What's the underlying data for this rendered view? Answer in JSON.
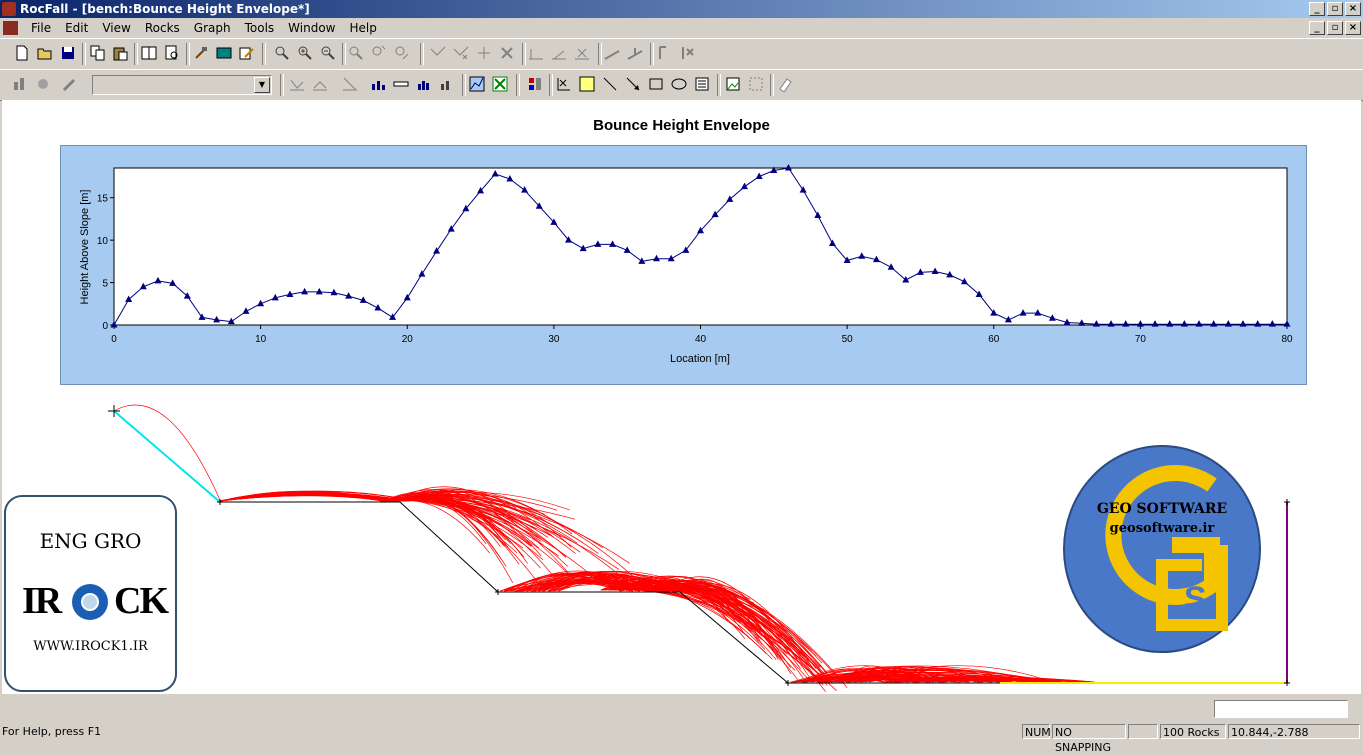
{
  "window": {
    "title": "RocFall - [bench:Bounce Height Envelope*]"
  },
  "menu": {
    "items": [
      "File",
      "Edit",
      "View",
      "Rocks",
      "Graph",
      "Tools",
      "Window",
      "Help"
    ]
  },
  "chart_title": "Bounce Height Envelope",
  "chart_data": {
    "type": "line",
    "title": "Bounce Height Envelope",
    "xlabel": "Location [m]",
    "ylabel": "Height Above Slope [m]",
    "xlim": [
      0,
      80
    ],
    "ylim": [
      0,
      18.5
    ],
    "x_ticks": [
      "0",
      "10",
      "20",
      "30",
      "40",
      "50",
      "60",
      "70",
      "80"
    ],
    "y_ticks": [
      "0",
      "5",
      "10",
      "15"
    ],
    "series": [
      {
        "marker": "triangle",
        "color": "#000080",
        "x": [
          0,
          1,
          2,
          3,
          4,
          5,
          6,
          7,
          8,
          9,
          10,
          11,
          12,
          13,
          14,
          15,
          16,
          17,
          18,
          19,
          20,
          21,
          22,
          23,
          24,
          25,
          26,
          27,
          28,
          29,
          30,
          31,
          32,
          33,
          34,
          35,
          36,
          37,
          38,
          39,
          40,
          41,
          42,
          43,
          44,
          45,
          46,
          47,
          48,
          49,
          50,
          51,
          52,
          53,
          54,
          55,
          56,
          57,
          58,
          59,
          60,
          61,
          62,
          63,
          64,
          65,
          66,
          67,
          68,
          69,
          70,
          71,
          72,
          73,
          74,
          75,
          76,
          77,
          78,
          79,
          80
        ],
        "y": [
          0.0,
          3.0,
          4.5,
          5.2,
          4.9,
          3.4,
          0.9,
          0.6,
          0.4,
          1.6,
          2.5,
          3.2,
          3.6,
          3.9,
          3.9,
          3.8,
          3.4,
          2.9,
          2.0,
          0.9,
          3.2,
          6.0,
          8.7,
          11.3,
          13.7,
          15.8,
          17.8,
          17.2,
          15.9,
          14.0,
          12.1,
          10.0,
          9.0,
          9.5,
          9.5,
          8.8,
          7.5,
          7.8,
          7.8,
          8.8,
          11.1,
          13.0,
          14.8,
          16.3,
          17.5,
          18.2,
          18.5,
          15.9,
          12.9,
          9.6,
          7.6,
          8.1,
          7.7,
          6.8,
          5.3,
          6.2,
          6.3,
          5.9,
          5.1,
          3.6,
          1.4,
          0.6,
          1.4,
          1.4,
          0.8,
          0.3,
          0.2,
          0.1,
          0.1,
          0.1,
          0.1,
          0.1,
          0.1,
          0.1,
          0.1,
          0.1,
          0.1,
          0.1,
          0.1,
          0.1,
          0.1
        ]
      }
    ],
    "grid": false
  },
  "logo_left": {
    "line1": "ENG GRO",
    "line2a": "IR",
    "line2b": "CK",
    "line3": "WWW.IROCK1.IR"
  },
  "logo_right": {
    "line1": "GEO SOFTWARE",
    "line2": "geosoftware.ir"
  },
  "statusbar": {
    "help": "For Help, press F1",
    "num": "NUM",
    "snap": "NO SNAPPING",
    "empty": "",
    "rocks": "100 Rocks",
    "coords": "10.844,-2.788"
  },
  "colors": {
    "trajectories": "#ff0000",
    "envelope_panel": "#a6caf0",
    "slope_segment": "#00e5ee",
    "end_line": "#ffe800",
    "barrier": "#800080"
  }
}
